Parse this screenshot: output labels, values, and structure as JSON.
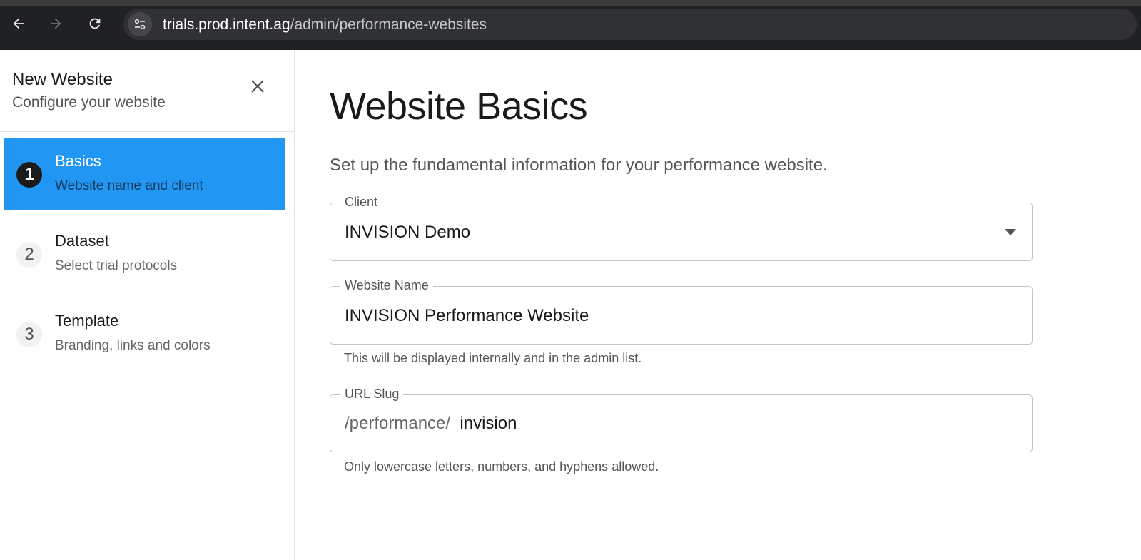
{
  "browser": {
    "url_host": "trials.prod.intent.ag",
    "url_path": "/admin/performance-websites"
  },
  "sidebar": {
    "title": "New Website",
    "subtitle": "Configure your website",
    "steps": [
      {
        "number": "1",
        "title": "Basics",
        "description": "Website name and client",
        "active": true
      },
      {
        "number": "2",
        "title": "Dataset",
        "description": "Select trial protocols",
        "active": false
      },
      {
        "number": "3",
        "title": "Template",
        "description": "Branding, links and colors",
        "active": false
      }
    ]
  },
  "main": {
    "title": "Website Basics",
    "description": "Set up the fundamental information for your performance website.",
    "client": {
      "label": "Client",
      "value": "INVISION Demo"
    },
    "website_name": {
      "label": "Website Name",
      "value": "INVISION Performance Website",
      "helper": "This will be displayed internally and in the admin list."
    },
    "url_slug": {
      "label": "URL Slug",
      "prefix": "/performance/",
      "value": "invision",
      "helper": "Only lowercase letters, numbers, and hyphens allowed."
    }
  },
  "colors": {
    "accent": "#2196f3",
    "browser_bg": "#202124"
  },
  "icons": [
    "back-arrow-icon",
    "forward-arrow-icon",
    "reload-icon",
    "site-settings-icon",
    "close-icon",
    "dropdown-caret-icon"
  ]
}
